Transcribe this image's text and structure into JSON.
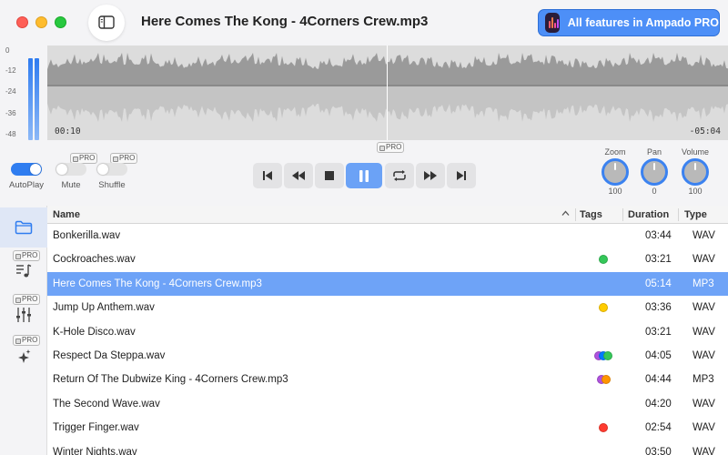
{
  "window": {
    "title": "Here Comes The Kong - 4Corners Crew.mp3",
    "pro_button_label": "All features in Ampado PRO"
  },
  "meter": {
    "labels": [
      "0",
      "-12",
      "-24",
      "-36",
      "-48"
    ]
  },
  "waveform": {
    "elapsed": "00:10",
    "remaining": "-05:04"
  },
  "pro_badge": "PRO",
  "toggles": [
    {
      "label": "AutoPlay",
      "on": true,
      "pro": false
    },
    {
      "label": "Mute",
      "on": false,
      "pro": true
    },
    {
      "label": "Shuffle",
      "on": false,
      "pro": true
    }
  ],
  "transport": [
    {
      "icon": "skip-previous-icon",
      "active": false
    },
    {
      "icon": "rewind-icon",
      "active": false
    },
    {
      "icon": "stop-icon",
      "active": false
    },
    {
      "icon": "pause-icon",
      "active": true
    },
    {
      "icon": "repeat-icon",
      "active": false
    },
    {
      "icon": "fast-forward-icon",
      "active": false
    },
    {
      "icon": "skip-next-icon",
      "active": false
    }
  ],
  "knobs": [
    {
      "label": "Zoom",
      "value": "100"
    },
    {
      "label": "Pan",
      "value": "0"
    },
    {
      "label": "Volume",
      "value": "100"
    }
  ],
  "sidebar": [
    {
      "icon": "folder-icon",
      "selected": true,
      "pro": false
    },
    {
      "icon": "playlist-icon",
      "selected": false,
      "pro": true
    },
    {
      "icon": "equalizer-icon",
      "selected": false,
      "pro": true
    },
    {
      "icon": "sparkles-icon",
      "selected": false,
      "pro": true
    }
  ],
  "list": {
    "columns": {
      "name": "Name",
      "tags": "Tags",
      "duration": "Duration",
      "type": "Type"
    },
    "rows": [
      {
        "name": "Bonkerilla.wav",
        "tags": [],
        "duration": "03:44",
        "type": "WAV",
        "selected": false
      },
      {
        "name": "Cockroaches.wav",
        "tags": [
          "#34c759"
        ],
        "duration": "03:21",
        "type": "WAV",
        "selected": false
      },
      {
        "name": "Here Comes The Kong - 4Corners Crew.mp3",
        "tags": [],
        "duration": "05:14",
        "type": "MP3",
        "selected": true
      },
      {
        "name": "Jump Up Anthem.wav",
        "tags": [
          "#ffcc00"
        ],
        "duration": "03:36",
        "type": "WAV",
        "selected": false
      },
      {
        "name": "K-Hole Disco.wav",
        "tags": [],
        "duration": "03:21",
        "type": "WAV",
        "selected": false
      },
      {
        "name": "Respect Da Steppa.wav",
        "tags": [
          "#af52de",
          "#007aff",
          "#34c759"
        ],
        "duration": "04:05",
        "type": "WAV",
        "selected": false
      },
      {
        "name": "Return Of The Dubwize King - 4Corners Crew.mp3",
        "tags": [
          "#af52de",
          "#ff9500"
        ],
        "duration": "04:44",
        "type": "MP3",
        "selected": false
      },
      {
        "name": "The Second Wave.wav",
        "tags": [],
        "duration": "04:20",
        "type": "WAV",
        "selected": false
      },
      {
        "name": "Trigger Finger.wav",
        "tags": [
          "#ff3b30"
        ],
        "duration": "02:54",
        "type": "WAV",
        "selected": false
      },
      {
        "name": "Winter Nights.wav",
        "tags": [],
        "duration": "03:50",
        "type": "WAV",
        "selected": false
      }
    ]
  }
}
